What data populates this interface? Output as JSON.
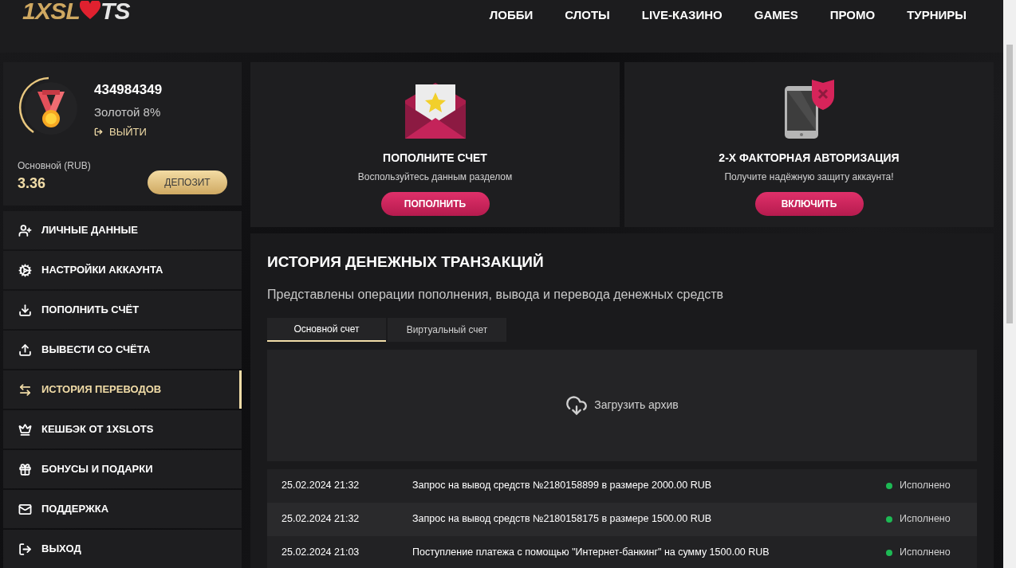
{
  "logo": {
    "left": "1XSL",
    "right": "TS"
  },
  "nav": [
    {
      "label": "ЛОББИ"
    },
    {
      "label": "СЛОТЫ"
    },
    {
      "label": "LIVE-КАЗИНО"
    },
    {
      "label": "GAMES"
    },
    {
      "label": "ПРОМО"
    },
    {
      "label": "ТУРНИРЫ"
    }
  ],
  "profile": {
    "id": "434984349",
    "status": "Золотой 8%",
    "logout": "ВЫЙТИ",
    "balance_label": "Основной (RUB)",
    "balance": "3.36",
    "deposit": "ДЕПОЗИТ"
  },
  "sidebar": {
    "items": [
      {
        "kind": "user",
        "label": "ЛИЧНЫЕ ДАННЫЕ",
        "selected": false
      },
      {
        "kind": "settings",
        "label": "НАСТРОЙКИ АККАУНТА",
        "selected": false
      },
      {
        "kind": "deposit",
        "label": "ПОПОЛНИТЬ СЧЁТ",
        "selected": false
      },
      {
        "kind": "withdraw",
        "label": "ВЫВЕСТИ СО СЧЁТА",
        "selected": false
      },
      {
        "kind": "history",
        "label": "ИСТОРИЯ ПЕРЕВОДОВ",
        "selected": true
      },
      {
        "kind": "cashback",
        "label": "КЕШБЭК ОТ 1XSLOTS",
        "selected": false
      },
      {
        "kind": "bonus",
        "label": "БОНУСЫ И ПОДАРКИ",
        "selected": false
      },
      {
        "kind": "support",
        "label": "ПОДДЕРЖКА",
        "selected": false
      },
      {
        "kind": "exit",
        "label": "ВЫХОД",
        "selected": false
      }
    ]
  },
  "promos": [
    {
      "kind": "envelope",
      "title": "ПОПОЛНИТЕ СЧЕТ",
      "text": "Воспользуйтесь данным разделом",
      "button": "ПОПОЛНИТЬ"
    },
    {
      "kind": "phone",
      "title": "2-Х ФАКТОРНАЯ АВТОРИЗАЦИЯ",
      "text": "Получите надёжную защиту аккаунта!",
      "button": "ВКЛЮЧИТЬ"
    }
  ],
  "history": {
    "title": "ИСТОРИЯ ДЕНЕЖНЫХ ТРАНЗАКЦИЙ",
    "subtitle": "Представлены операции пополнения, вывода и перевода денежных средств",
    "tabs": [
      {
        "label": "Основной счет",
        "selected": true
      },
      {
        "label": "Виртуальный счет",
        "selected": false
      }
    ],
    "archive": "Загрузить архив",
    "rows": [
      {
        "date": "25.02.2024 21:32",
        "description": "Запрос на вывод средств №2180158899 в размере 2000.00 RUB",
        "status": "Исполнено",
        "color": "#1db954"
      },
      {
        "date": "25.02.2024 21:32",
        "description": "Запрос на вывод средств №2180158175 в размере 1500.00 RUB",
        "status": "Исполнено",
        "color": "#1db954"
      },
      {
        "date": "25.02.2024 21:03",
        "description": "Поступление платежа с помощью \"Интернет-банкинг\" на сумму 1500.00 RUB",
        "status": "Исполнено",
        "color": "#1db954"
      }
    ]
  }
}
